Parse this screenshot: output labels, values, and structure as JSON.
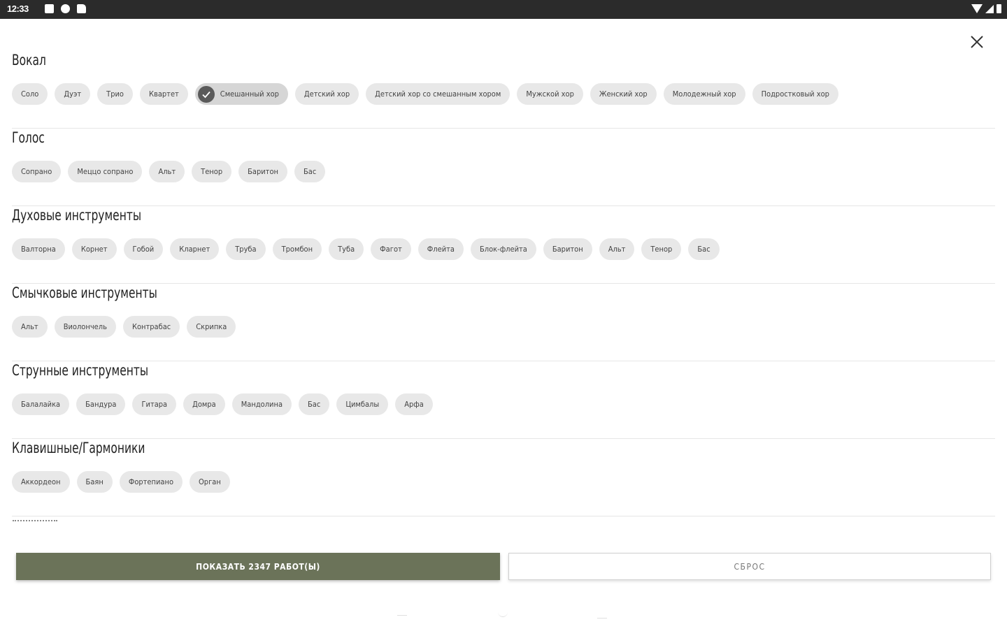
{
  "status_bar": {
    "time": "12:33",
    "left_icons": [
      "notification-icon",
      "p-app-icon",
      "sd-card-icon"
    ],
    "right_icons": [
      "wifi-icon",
      "signal-icon",
      "battery-icon"
    ]
  },
  "close": {
    "icon": "close-icon"
  },
  "sections": [
    {
      "title": "Вокал",
      "chips": [
        {
          "label": "Соло",
          "selected": false
        },
        {
          "label": "Дуэт",
          "selected": false
        },
        {
          "label": "Трио",
          "selected": false
        },
        {
          "label": "Квартет",
          "selected": false
        },
        {
          "label": "Смешанный хор",
          "selected": true
        },
        {
          "label": "Детский хор",
          "selected": false
        },
        {
          "label": "Детский хор со смешанным хором",
          "selected": false
        },
        {
          "label": "Мужской хор",
          "selected": false
        },
        {
          "label": "Женский хор",
          "selected": false
        },
        {
          "label": "Молодежный хор",
          "selected": false
        },
        {
          "label": "Подростковый хор",
          "selected": false
        }
      ]
    },
    {
      "title": "Голос",
      "chips": [
        {
          "label": "Сопрано",
          "selected": false
        },
        {
          "label": "Меццо сопрано",
          "selected": false
        },
        {
          "label": "Альт",
          "selected": false
        },
        {
          "label": "Тенор",
          "selected": false
        },
        {
          "label": "Баритон",
          "selected": false
        },
        {
          "label": "Бас",
          "selected": false
        }
      ]
    },
    {
      "title": "Духовые инструменты",
      "chips": [
        {
          "label": "Валторна",
          "selected": false
        },
        {
          "label": "Корнет",
          "selected": false
        },
        {
          "label": "Гобой",
          "selected": false
        },
        {
          "label": "Кларнет",
          "selected": false
        },
        {
          "label": "Труба",
          "selected": false
        },
        {
          "label": "Тромбон",
          "selected": false
        },
        {
          "label": "Туба",
          "selected": false
        },
        {
          "label": "Фагот",
          "selected": false
        },
        {
          "label": "Флейта",
          "selected": false
        },
        {
          "label": "Блок-флейта",
          "selected": false
        },
        {
          "label": "Баритон",
          "selected": false
        },
        {
          "label": "Альт",
          "selected": false
        },
        {
          "label": "Тенор",
          "selected": false
        },
        {
          "label": "Бас",
          "selected": false
        }
      ]
    },
    {
      "title": "Смычковые инструменты",
      "chips": [
        {
          "label": "Альт",
          "selected": false
        },
        {
          "label": "Виолончель",
          "selected": false
        },
        {
          "label": "Контрабас",
          "selected": false
        },
        {
          "label": "Скрипка",
          "selected": false
        }
      ]
    },
    {
      "title": "Струнные инструменты",
      "chips": [
        {
          "label": "Балалайка",
          "selected": false
        },
        {
          "label": "Бандура",
          "selected": false
        },
        {
          "label": "Гитара",
          "selected": false
        },
        {
          "label": "Домра",
          "selected": false
        },
        {
          "label": "Мандолина",
          "selected": false
        },
        {
          "label": "Бас",
          "selected": false
        },
        {
          "label": "Цимбалы",
          "selected": false
        },
        {
          "label": "Арфа",
          "selected": false
        }
      ]
    },
    {
      "title": "Клавишные/Гармоники",
      "chips": [
        {
          "label": "Аккордеон",
          "selected": false
        },
        {
          "label": "Баян",
          "selected": false
        },
        {
          "label": "Фортепиано",
          "selected": false
        },
        {
          "label": "Орган",
          "selected": false
        }
      ]
    }
  ],
  "buttons": {
    "show_label": "ПОКАЗАТЬ 2347 РАБОТ(Ы)",
    "reset_label": "СБРОС"
  },
  "colors": {
    "primary": "#6b7359",
    "chip_bg": "#e8e8e8",
    "chip_selected_bg": "#d6d6d6",
    "status_bar": "#2b2b2b"
  }
}
